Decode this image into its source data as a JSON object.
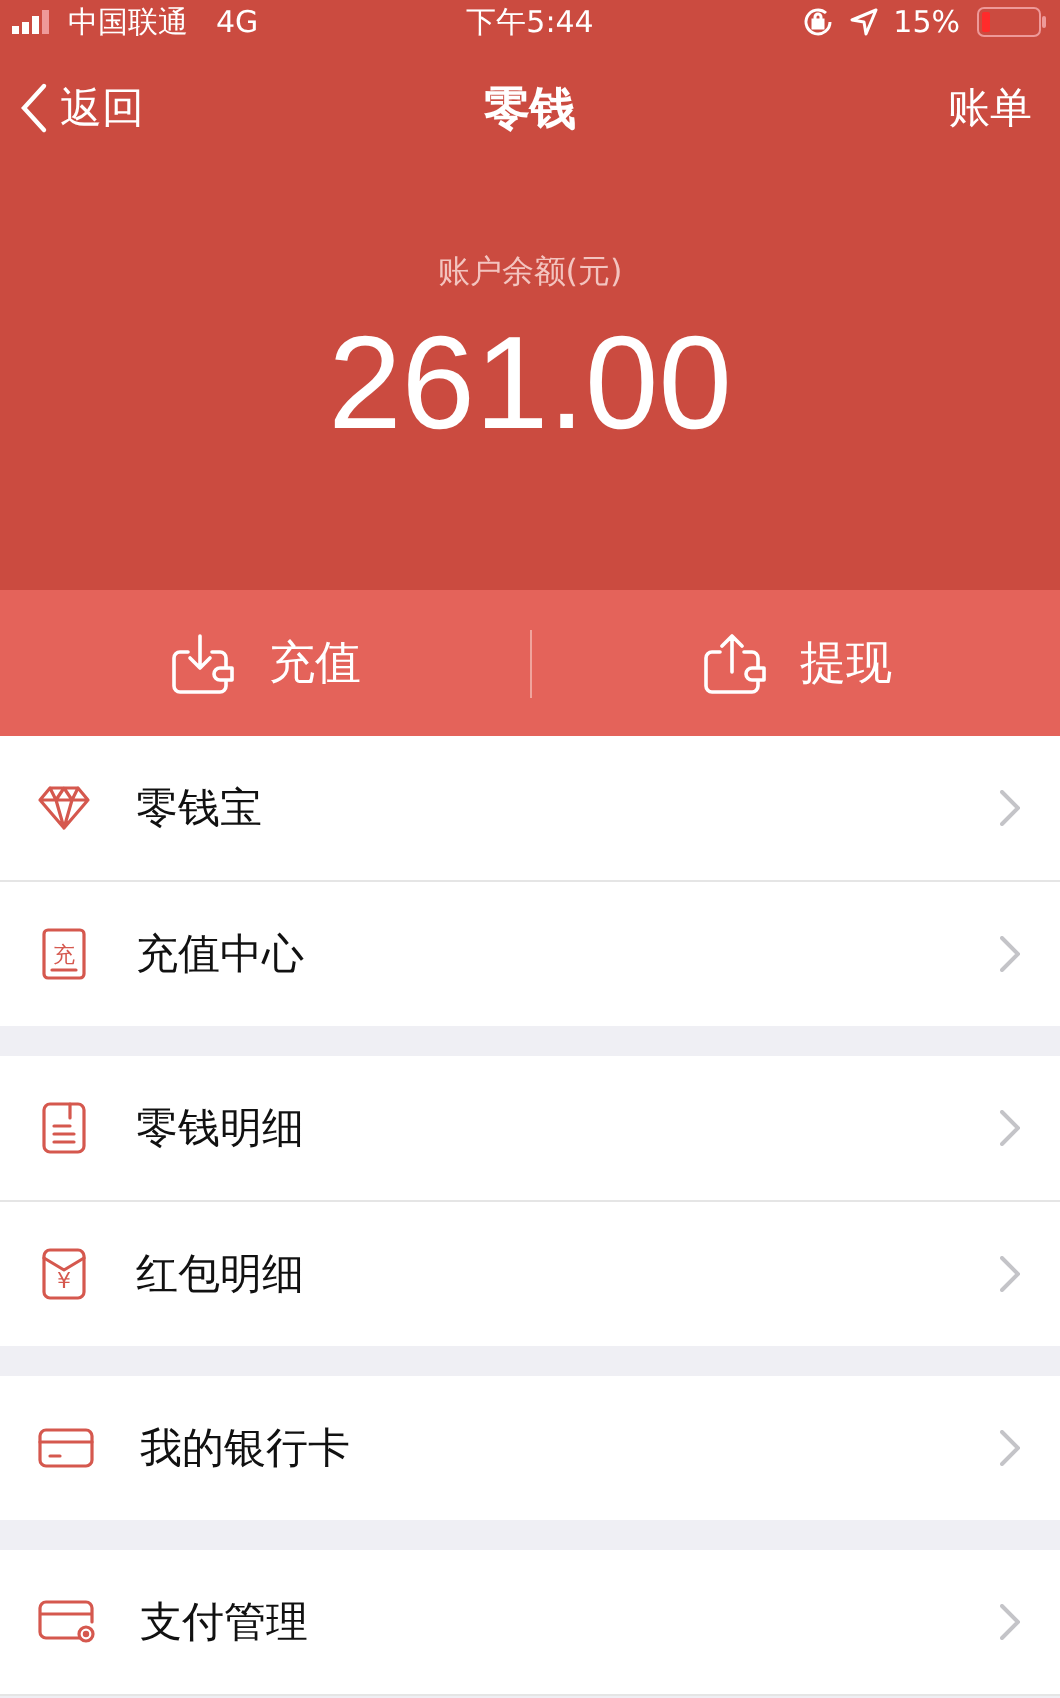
{
  "status_bar": {
    "carrier": "中国联通",
    "network": "4G",
    "time": "下午5:44",
    "battery": "15%"
  },
  "nav": {
    "back": "返回",
    "title": "零钱",
    "action": "账单"
  },
  "balance": {
    "label": "账户余额(元)",
    "amount": "261.00"
  },
  "actions": [
    {
      "kind": "deposit",
      "label": "充值"
    },
    {
      "kind": "withdraw",
      "label": "提现"
    }
  ],
  "groups": [
    {
      "items": [
        {
          "kind": "diamond",
          "label": "零钱宝"
        },
        {
          "kind": "stamp",
          "icon_text": "充",
          "label": "充值中心"
        }
      ]
    },
    {
      "items": [
        {
          "kind": "document",
          "label": "零钱明细"
        },
        {
          "kind": "envelope",
          "icon_text": "¥",
          "label": "红包明细"
        }
      ]
    },
    {
      "items": [
        {
          "kind": "card",
          "label": "我的银行卡"
        }
      ]
    },
    {
      "items": [
        {
          "kind": "wallet",
          "label": "支付管理"
        }
      ]
    }
  ]
}
